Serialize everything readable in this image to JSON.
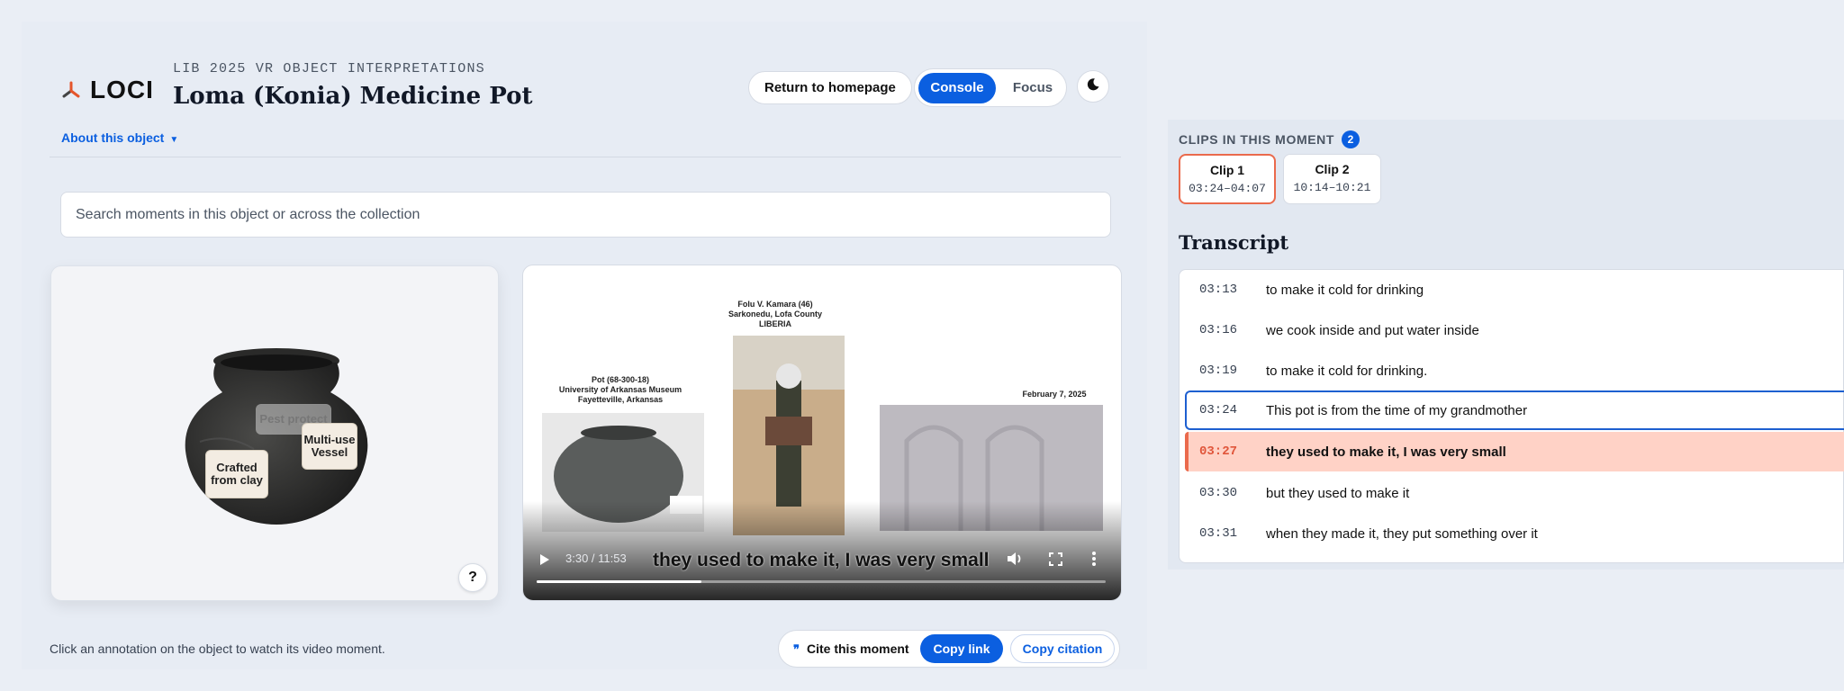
{
  "header": {
    "logo_text": "LOCI",
    "eyebrow": "LIB 2025 VR OBJECT INTERPRETATIONS",
    "title": "Loma (Konia) Medicine Pot",
    "return_label": "Return to homepage",
    "mode_console": "Console",
    "mode_focus": "Focus",
    "theme_icon": "moon-icon"
  },
  "about_label": "About this object",
  "search": {
    "placeholder": "Search moments in this object or across the collection"
  },
  "object_viewer": {
    "annotations": [
      "Pest protect",
      "Multi-use Vessel",
      "Crafted from clay"
    ],
    "help_label": "?"
  },
  "video": {
    "slide_left": "Pot (68-300-18)\nUniversity of Arkansas Museum\nFayetteville, Arkansas",
    "slide_center": "Folu V. Kamara (46)\nSarkonedu, Lofa County\nLIBERIA",
    "slide_right": "February 7, 2025",
    "time_display": "3:30 / 11:53",
    "caption": "they used to make it, I was very small",
    "progress": 0.29
  },
  "hint": "Click an annotation on the object to watch its video moment.",
  "cite": {
    "label": "Cite this moment",
    "copy_link": "Copy link",
    "copy_citation": "Copy citation"
  },
  "clips": {
    "header": "CLIPS IN THIS MOMENT",
    "count": "2",
    "items": [
      {
        "name": "Clip 1",
        "range": "03:24–04:07"
      },
      {
        "name": "Clip 2",
        "range": "10:14–10:21"
      }
    ]
  },
  "transcript": {
    "title": "Transcript",
    "rows": [
      {
        "time": "03:13",
        "text": "to make it cold for drinking"
      },
      {
        "time": "03:16",
        "text": "we cook inside and put water inside"
      },
      {
        "time": "03:19",
        "text": "to make it cold for drinking."
      },
      {
        "time": "03:24",
        "text": "This pot is from the time of my grandmother"
      },
      {
        "time": "03:27",
        "text": "they used to make it, I was very small"
      },
      {
        "time": "03:30",
        "text": "but they used to make it"
      },
      {
        "time": "03:31",
        "text": "when they made it, they put something over it"
      }
    ]
  },
  "colors": {
    "accent": "#0b5fe0",
    "highlight": "#ffd2c6",
    "highlight_border": "#ea6a4c"
  }
}
